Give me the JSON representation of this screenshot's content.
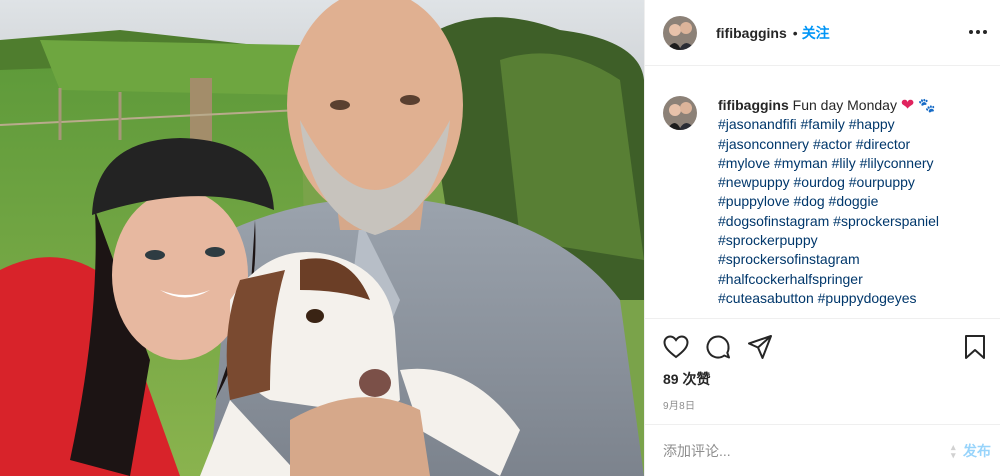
{
  "header": {
    "username": "fifibaggins",
    "separator": "•",
    "follow_label": "关注"
  },
  "caption": {
    "username": "fifibaggins",
    "text": "Fun day Monday",
    "emoji_heart": "❤",
    "emoji_paw": "🐾",
    "hashtags": [
      "#jasonandfifi #family #happy",
      "#jasonconnery #actor #director",
      "#mylove #myman #lily #lilyconnery",
      "#newpuppy #ourdog #ourpuppy",
      "#puppylove #dog #doggie",
      "#dogsofinstagram #sprockerspaniel",
      "#sprockerpuppy",
      "#sprockersofinstagram",
      "#halfcockerhalfspringer",
      "#cuteasabutton #puppydogeyes"
    ]
  },
  "actions": {
    "like_icon": "heart-icon",
    "comment_icon": "comment-icon",
    "share_icon": "share-icon",
    "save_icon": "bookmark-icon"
  },
  "likes": "89 次赞",
  "date": "9月8日",
  "comment_box": {
    "placeholder": "添加评论...",
    "post_label": "发布"
  },
  "colors": {
    "accent": "#0095f6",
    "hashtag": "#00376b",
    "muted": "#8e8e8e",
    "border": "#efefef"
  }
}
